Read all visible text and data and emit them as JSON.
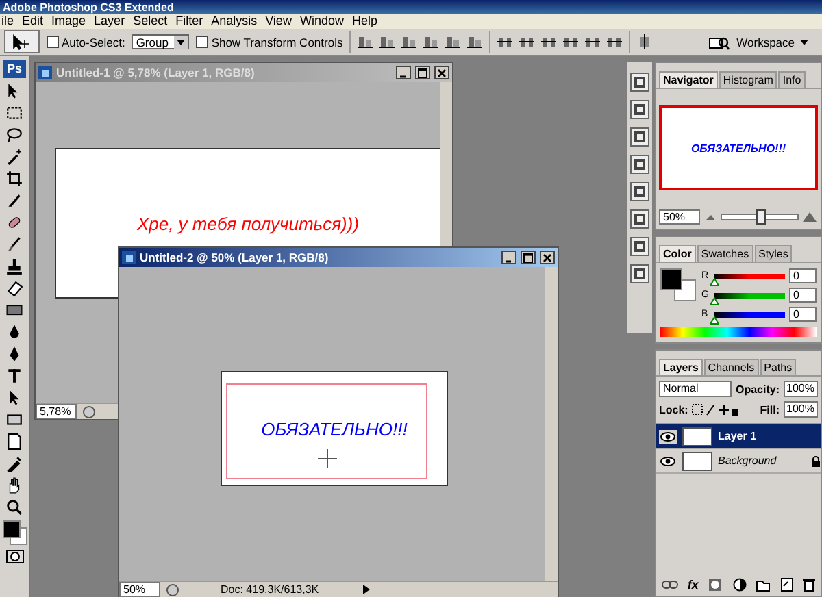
{
  "app_title": "Adobe Photoshop CS3 Extended",
  "menu": [
    "ile",
    "Edit",
    "Image",
    "Layer",
    "Select",
    "Filter",
    "Analysis",
    "View",
    "Window",
    "Help"
  ],
  "options": {
    "auto_select": {
      "label": "Auto-Select:",
      "checked": false
    },
    "auto_select_mode": "Group",
    "transform_controls": {
      "label": "Show Transform Controls",
      "checked": false
    },
    "workspace": "Workspace"
  },
  "toolbox": {
    "logo": "Ps"
  },
  "documents": [
    {
      "title": "Untitled-1 @ 5,78% (Layer 1, RGB/8)",
      "active": false,
      "canvas_text": "Хре, у тебя получиться)))",
      "color": "#ff0000",
      "zoom": "5,78%"
    },
    {
      "title": "Untitled-2 @ 50% (Layer 1, RGB/8)",
      "active": true,
      "canvas_text": "ОБЯЗАТЕЛЬНО!!!",
      "color": "#0000ff",
      "zoom": "50%",
      "doc_info": "Doc: 419,3K/613,3K"
    }
  ],
  "navigator": {
    "tabs": [
      {
        "label": "Navigator",
        "selected": true
      },
      {
        "label": "Histogram",
        "selected": false
      },
      {
        "label": "Info",
        "selected": false
      }
    ],
    "preview_text": "ОБЯЗАТЕЛЬНО!!!",
    "zoom": "50%",
    "level": 0.5
  },
  "color_panel": {
    "tabs": [
      {
        "label": "Color",
        "selected": true
      },
      {
        "label": "Swatches",
        "selected": false
      },
      {
        "label": "Styles",
        "selected": false
      }
    ],
    "channels": [
      {
        "label": "R",
        "value": "0",
        "level": 0,
        "color": "#ff0000"
      },
      {
        "label": "G",
        "value": "0",
        "level": 0,
        "color": "#00c000"
      },
      {
        "label": "B",
        "value": "0",
        "level": 0,
        "color": "#0000ff"
      }
    ]
  },
  "layers_panel": {
    "tabs": [
      {
        "label": "Layers",
        "selected": true
      },
      {
        "label": "Channels",
        "selected": false
      },
      {
        "label": "Paths",
        "selected": false
      }
    ],
    "blend_mode": "Normal",
    "opacity_label": "Opacity:",
    "opacity": "100%",
    "lock_label": "Lock:",
    "fill_label": "Fill:",
    "fill": "100%",
    "fx": "fx",
    "layers": [
      {
        "name": "Layer 1",
        "selected": true,
        "locked": false,
        "visible": true
      },
      {
        "name": "Background",
        "selected": false,
        "locked": true,
        "visible": true
      }
    ]
  }
}
